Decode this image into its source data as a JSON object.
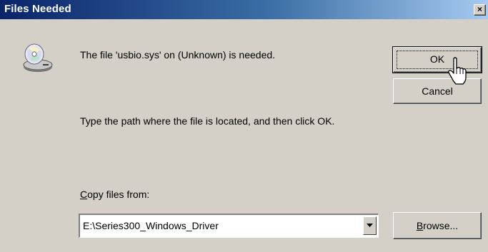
{
  "window": {
    "title": "Files Needed",
    "close_glyph": "×"
  },
  "message": {
    "line1": "The file 'usbio.sys' on (Unknown) is needed.",
    "line2": "Type the path where the file is located, and then click OK."
  },
  "copy_from": {
    "label_accel": "C",
    "label_rest": "opy files from:",
    "value": "E:\\Series300_Windows_Driver"
  },
  "buttons": {
    "ok": "OK",
    "cancel": "Cancel",
    "browse_accel": "B",
    "browse_rest": "rowse..."
  },
  "icons": {
    "disk": "cd-drive-icon",
    "cursor": "hand-pointer-cursor"
  },
  "colors": {
    "face": "#d4d0c8",
    "title_start": "#0a246a",
    "title_end": "#a6caf0"
  }
}
